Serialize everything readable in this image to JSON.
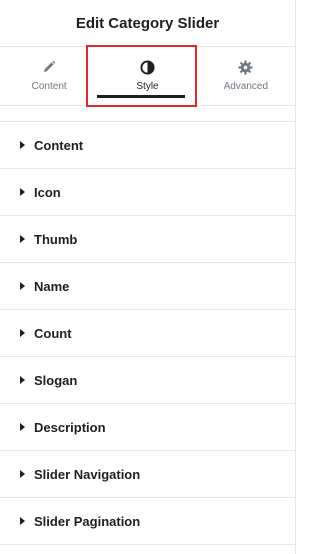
{
  "header": {
    "title": "Edit Category Slider"
  },
  "tabs": [
    {
      "label": "Content",
      "icon": "pencil-icon"
    },
    {
      "label": "Style",
      "icon": "contrast-icon",
      "active": true
    },
    {
      "label": "Advanced",
      "icon": "gear-icon"
    }
  ],
  "sections": [
    {
      "label": "Content"
    },
    {
      "label": "Icon"
    },
    {
      "label": "Thumb"
    },
    {
      "label": "Name"
    },
    {
      "label": "Count"
    },
    {
      "label": "Slogan"
    },
    {
      "label": "Description"
    },
    {
      "label": "Slider Navigation"
    },
    {
      "label": "Slider Pagination"
    }
  ],
  "colors": {
    "text": "#1f1f1f",
    "muted": "#6d7882",
    "divider": "#e6e6e6",
    "highlight": "#e02a2a"
  }
}
